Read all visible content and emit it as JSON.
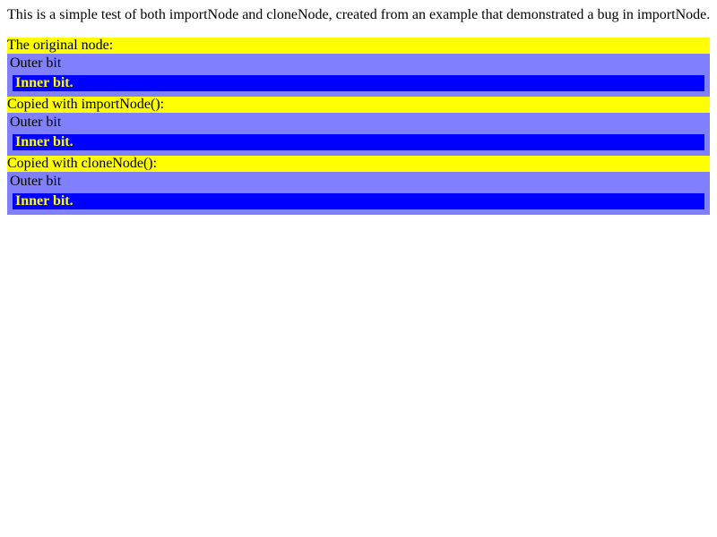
{
  "intro": "This is a simple test of both importNode and cloneNode, created from an example that demonstrated a bug in importNode.",
  "sections": [
    {
      "label": "The original node:",
      "outer": "Outer bit",
      "inner": "Inner bit."
    },
    {
      "label": "Copied with importNode():",
      "outer": "Outer bit",
      "inner": "Inner bit."
    },
    {
      "label": "Copied with cloneNode():",
      "outer": "Outer bit",
      "inner": "Inner bit."
    }
  ],
  "colors": {
    "label_background": "#ffff00",
    "outer_background": "#8080ff",
    "inner_background": "#0000ff",
    "inner_text": "#ffff00"
  }
}
